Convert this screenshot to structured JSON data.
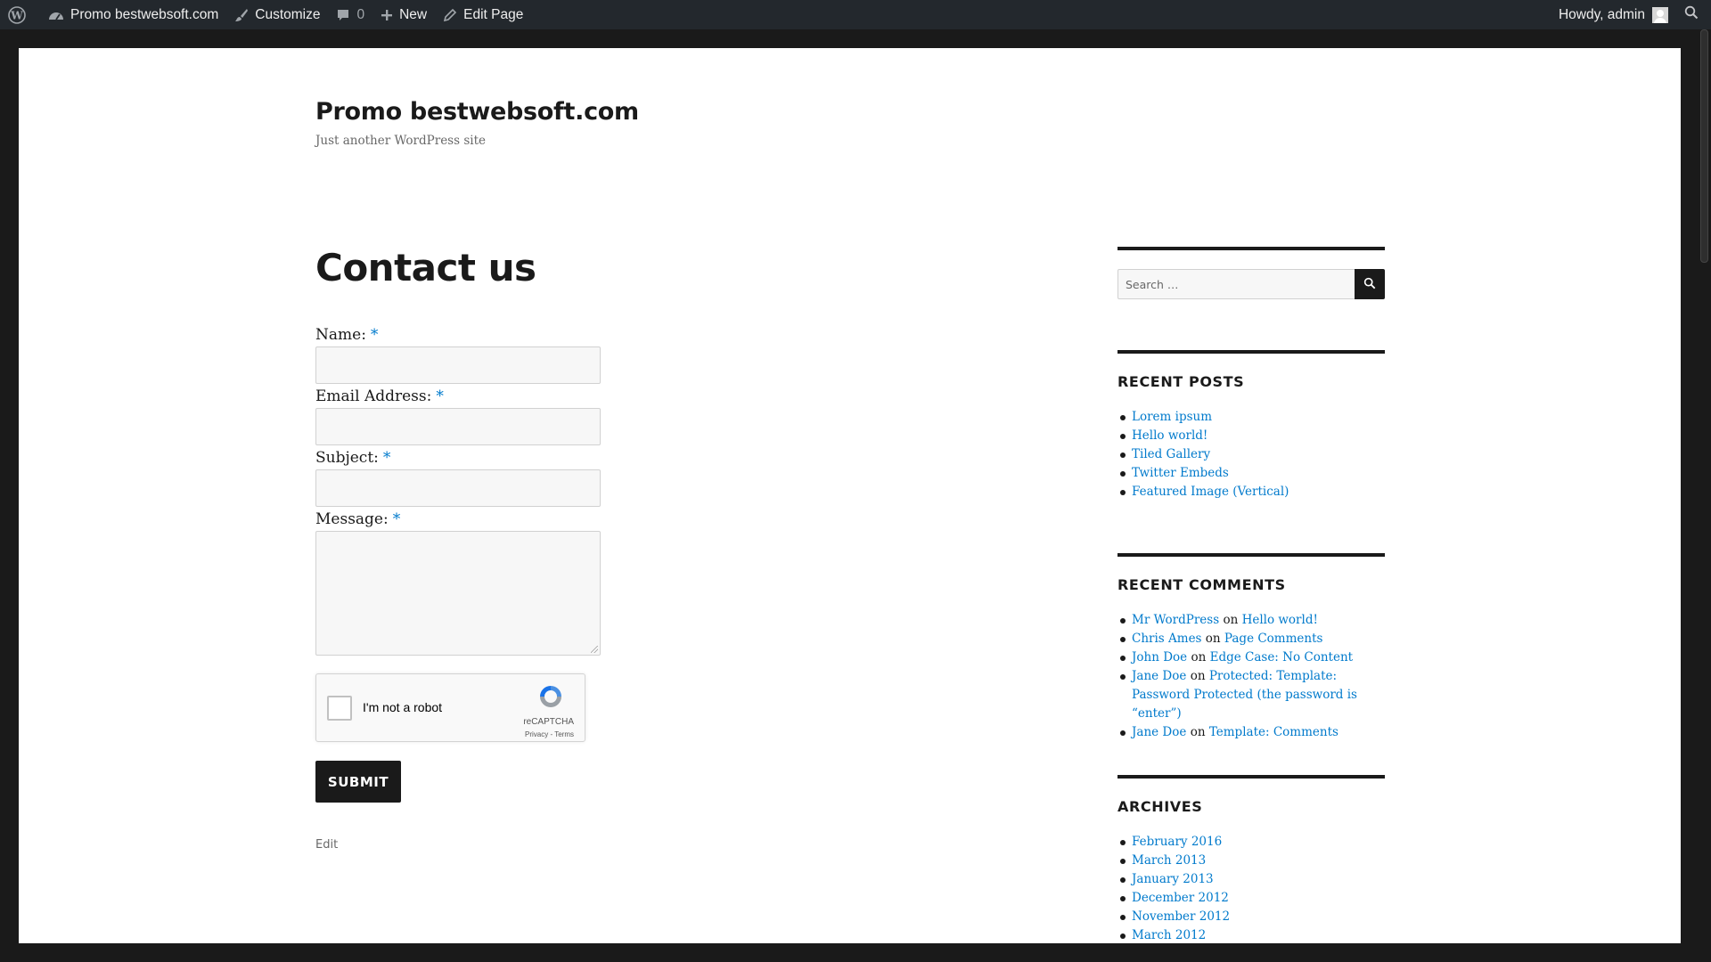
{
  "adminbar": {
    "site_name": "Promo bestwebsoft.com",
    "customize": "Customize",
    "comments_count": "0",
    "new": "New",
    "edit_page": "Edit Page",
    "howdy": "Howdy, admin"
  },
  "header": {
    "site_title": "Promo bestwebsoft.com",
    "tagline": "Just another WordPress site"
  },
  "content": {
    "title": "Contact us",
    "required_marker": "*",
    "fields": [
      {
        "label": "Name:"
      },
      {
        "label": "Email Address:"
      },
      {
        "label": "Subject:"
      },
      {
        "label": "Message:"
      }
    ],
    "recaptcha": {
      "label": "I'm not a robot",
      "brand": "reCAPTCHA",
      "links": "Privacy - Terms"
    },
    "submit_label": "SUBMIT",
    "edit_label": "Edit"
  },
  "sidebar": {
    "search_placeholder": "Search …",
    "recent_posts_title": "RECENT POSTS",
    "recent_posts": [
      "Lorem ipsum",
      "Hello world!",
      "Tiled Gallery",
      "Twitter Embeds",
      "Featured Image (Vertical)"
    ],
    "recent_comments_title": "RECENT COMMENTS",
    "comment_on": "on",
    "recent_comments": [
      {
        "author": "Mr WordPress",
        "post": "Hello world!"
      },
      {
        "author": "Chris Ames",
        "post": "Page Comments"
      },
      {
        "author": "John Doe",
        "post": "Edge Case: No Content"
      },
      {
        "author": "Jane Doe",
        "post": "Protected: Template: Password Protected (the password is “enter”)"
      },
      {
        "author": "Jane Doe",
        "post": "Template: Comments"
      }
    ],
    "archives_title": "ARCHIVES",
    "archives": [
      "February 2016",
      "March 2013",
      "January 2013",
      "December 2012",
      "November 2012",
      "March 2012"
    ]
  },
  "colors": {
    "adminbar_bg": "#23282d",
    "link": "#007acc",
    "text": "#1a1a1a",
    "page_border": "#1a1a1a"
  },
  "icons": [
    "wordpress-icon",
    "dashboard-icon",
    "brush-icon",
    "comment-icon",
    "plus-icon",
    "pencil-icon",
    "search-icon"
  ]
}
